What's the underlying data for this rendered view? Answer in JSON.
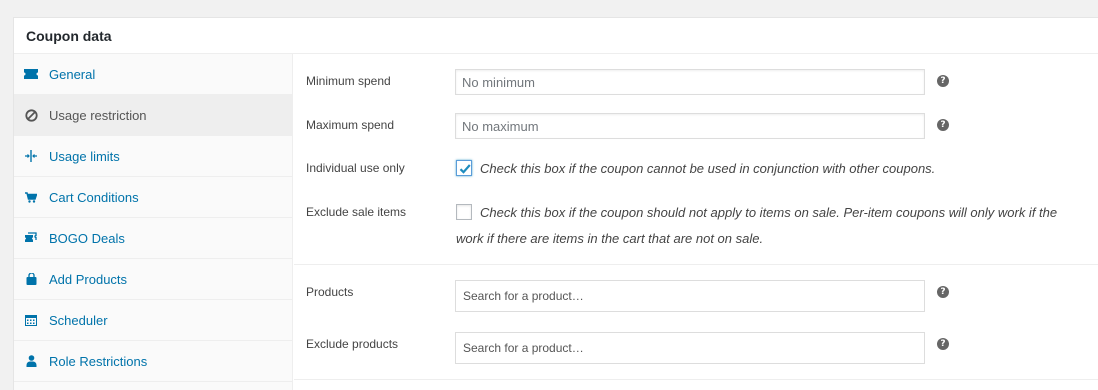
{
  "panel": {
    "title": "Coupon data"
  },
  "sidebar": {
    "items": [
      {
        "label": "General",
        "icon": "ticket-icon"
      },
      {
        "label": "Usage restriction",
        "icon": "block-icon"
      },
      {
        "label": "Usage limits",
        "icon": "limits-icon"
      },
      {
        "label": "Cart Conditions",
        "icon": "cart-icon"
      },
      {
        "label": "BOGO Deals",
        "icon": "bogo-icon"
      },
      {
        "label": "Add Products",
        "icon": "bag-icon"
      },
      {
        "label": "Scheduler",
        "icon": "calendar-icon"
      },
      {
        "label": "Role Restrictions",
        "icon": "user-icon"
      }
    ],
    "active_index": 1
  },
  "fields": {
    "min_spend": {
      "label": "Minimum spend",
      "placeholder": "No minimum",
      "help": "?"
    },
    "max_spend": {
      "label": "Maximum spend",
      "placeholder": "No maximum",
      "help": "?"
    },
    "individual_use": {
      "label": "Individual use only",
      "checked": true,
      "description": "Check this box if the coupon cannot be used in conjunction with other coupons."
    },
    "exclude_sale": {
      "label": "Exclude sale items",
      "checked": false,
      "description_line1": "Check this box if the coupon should not apply to items on sale. Per-item coupons will only work if the",
      "description_line2": "work if there are items in the cart that are not on sale."
    },
    "products": {
      "label": "Products",
      "placeholder": "Search for a product…",
      "help": "?"
    },
    "exclude_products": {
      "label": "Exclude products",
      "placeholder": "Search for a product…",
      "help": "?"
    }
  }
}
